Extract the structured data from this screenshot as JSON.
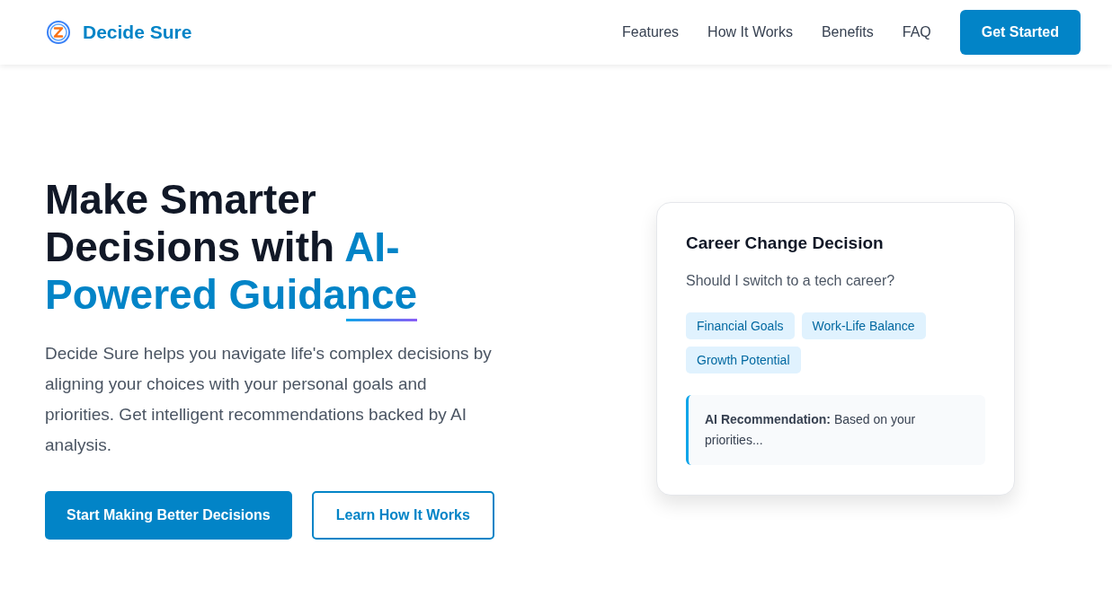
{
  "nav": {
    "brand": "Decide Sure",
    "links": [
      "Features",
      "How It Works",
      "Benefits",
      "FAQ"
    ],
    "cta": "Get Started"
  },
  "hero": {
    "heading": "Make Smarter Decisions with ",
    "heading_highlight": "AI-Powered Guidance",
    "description": "Decide Sure helps you navigate life's complex decisions by aligning your choices with your personal goals and priorities. Get intelligent recommendations backed by AI analysis.",
    "primary_button": "Start Making Better Decisions",
    "secondary_button": "Learn How It Works"
  },
  "card": {
    "title": "Career Change Decision",
    "question": "Should I switch to a tech career?",
    "tags": [
      "Financial Goals",
      "Work-Life Balance",
      "Growth Potential"
    ],
    "recommendation": "**AI Recommendation:** Based on your priorities..."
  }
}
